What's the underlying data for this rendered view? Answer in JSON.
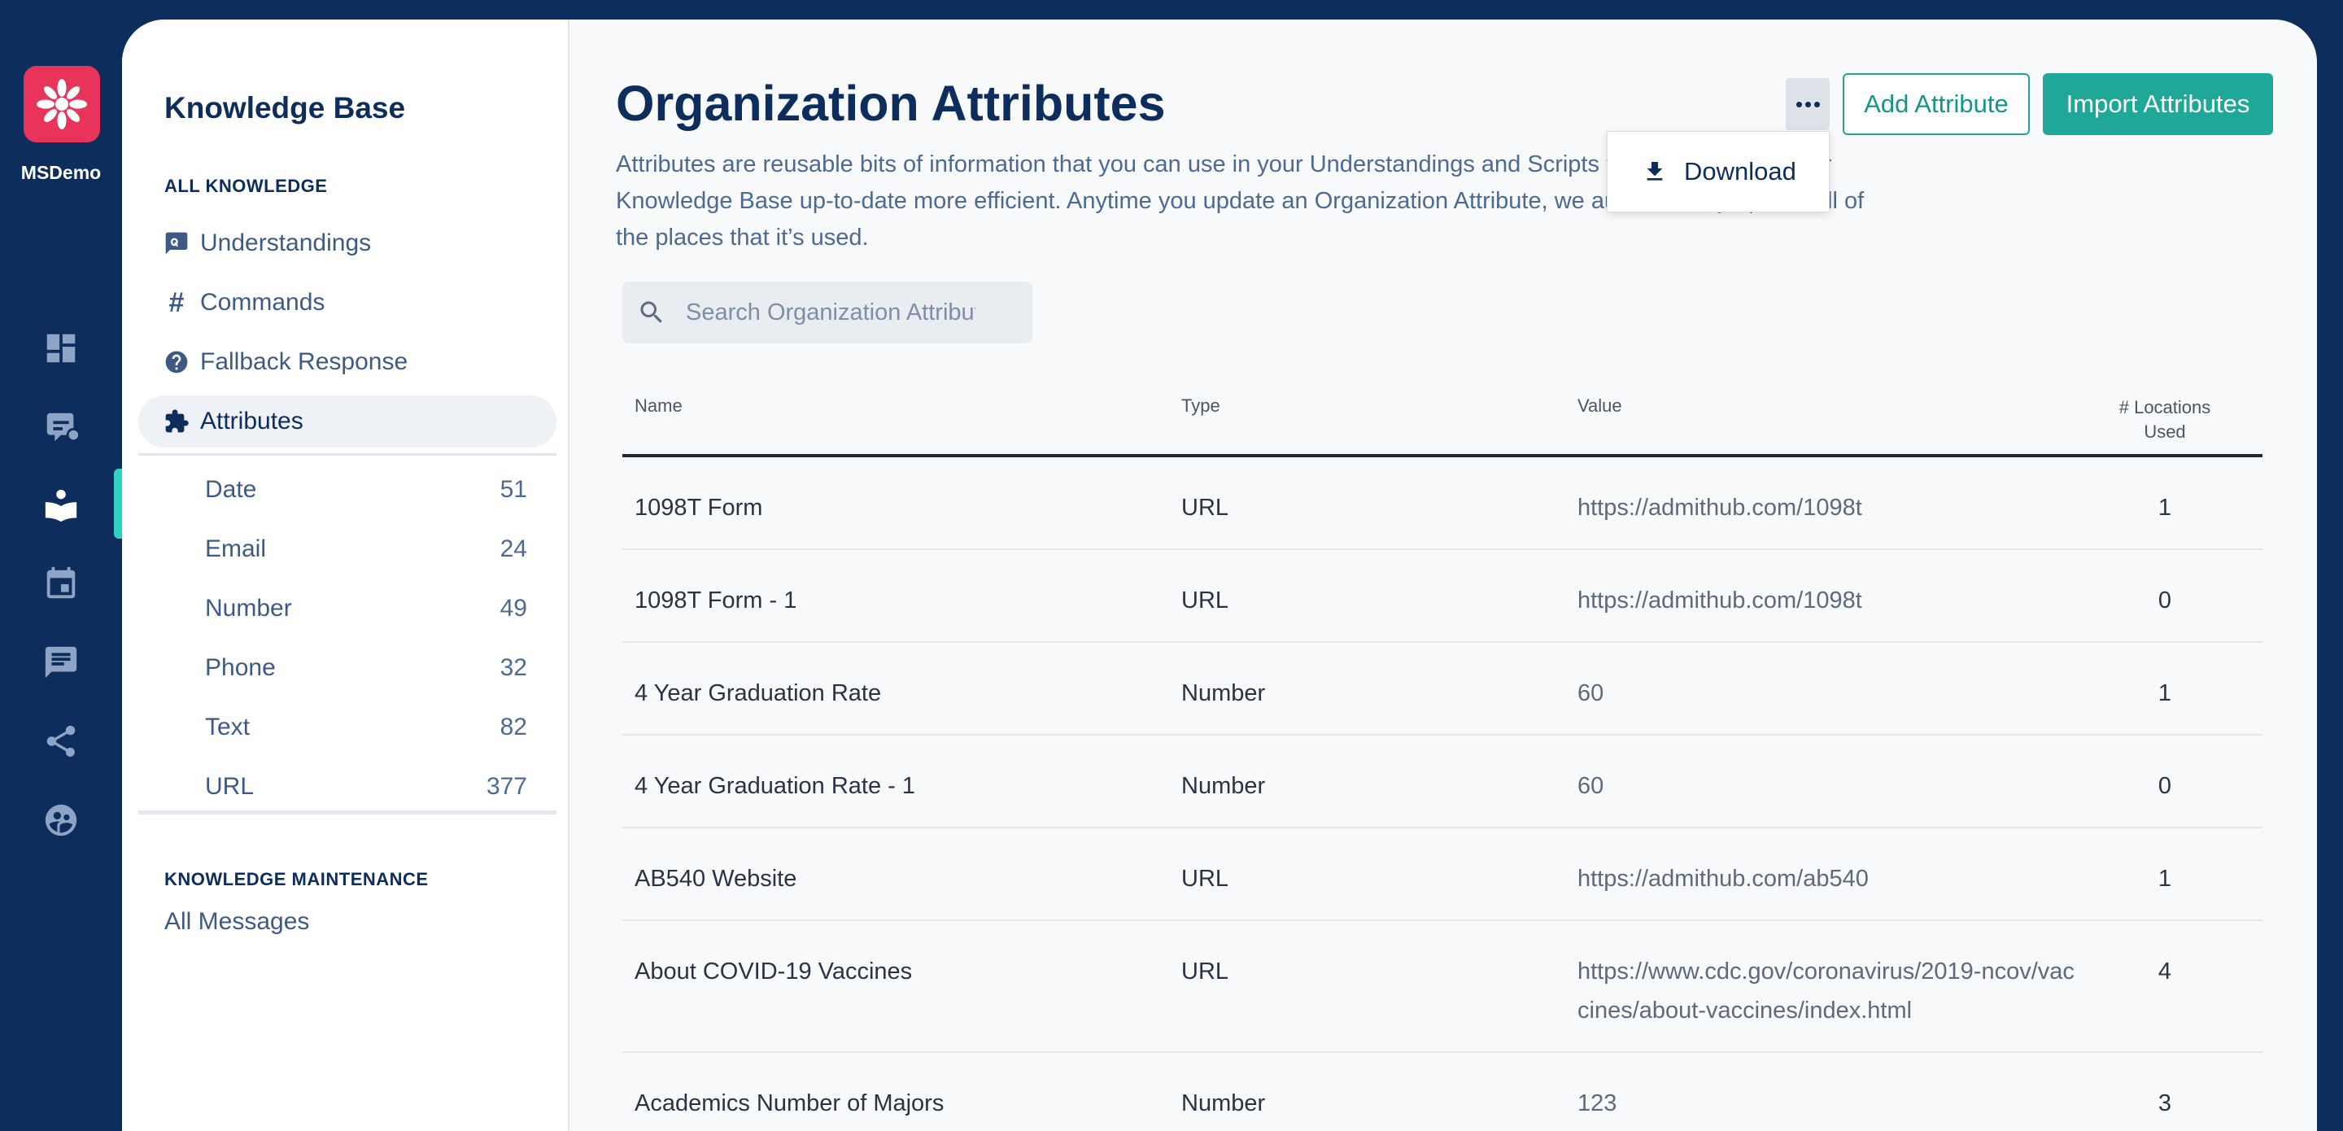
{
  "rail": {
    "org_name": "MSDemo",
    "items": [
      {
        "icon": "dashboard-icon"
      },
      {
        "icon": "conversations-icon"
      },
      {
        "icon": "knowledge-base-icon"
      },
      {
        "icon": "calendar-icon"
      },
      {
        "icon": "messages-icon"
      },
      {
        "icon": "share-icon"
      },
      {
        "icon": "audience-icon"
      }
    ],
    "active_index": 2
  },
  "sidebar": {
    "title": "Knowledge Base",
    "section_all": "ALL KNOWLEDGE",
    "nav": [
      {
        "label": "Understandings",
        "icon": "understanding-icon"
      },
      {
        "label": "Commands",
        "icon": "hash-icon",
        "glyph": "#"
      },
      {
        "label": "Fallback Response",
        "icon": "question-icon"
      },
      {
        "label": "Attributes",
        "icon": "puzzle-icon"
      }
    ],
    "attribute_types": [
      {
        "label": "Date",
        "count": "51"
      },
      {
        "label": "Email",
        "count": "24"
      },
      {
        "label": "Number",
        "count": "49"
      },
      {
        "label": "Phone",
        "count": "32"
      },
      {
        "label": "Text",
        "count": "82"
      },
      {
        "label": "URL",
        "count": "377"
      }
    ],
    "section_maintenance": "KNOWLEDGE MAINTENANCE",
    "all_messages": "All Messages"
  },
  "main": {
    "title": "Organization Attributes",
    "description": "Attributes are reusable bits of information that you can use in your Understandings and Scripts to make keeping your Knowledge Base up-to-date more efficient. Anytime you update an Organization Attribute, we automatically update all of the places that it’s used.",
    "add_button": "Add Attribute",
    "import_button": "Import Attributes",
    "menu": {
      "download": "Download"
    },
    "search": {
      "placeholder": "Search Organization Attributes",
      "value": ""
    }
  },
  "table": {
    "columns": {
      "name": "Name",
      "type": "Type",
      "value": "Value",
      "locations": "# Locations Used"
    },
    "rows": [
      {
        "name": "1098T Form",
        "type": "URL",
        "value": "https://admithub.com/1098t",
        "locations": "1"
      },
      {
        "name": "1098T Form - 1",
        "type": "URL",
        "value": "https://admithub.com/1098t",
        "locations": "0"
      },
      {
        "name": "4 Year Graduation Rate",
        "type": "Number",
        "value": "60",
        "locations": "1"
      },
      {
        "name": "4 Year Graduation Rate - 1",
        "type": "Number",
        "value": "60",
        "locations": "0"
      },
      {
        "name": "AB540 Website",
        "type": "URL",
        "value": "https://admithub.com/ab540",
        "locations": "1"
      },
      {
        "name": "About COVID-19 Vaccines",
        "type": "URL",
        "value": "https://www.cdc.gov/coronavirus/2019-ncov/vaccines/about-vaccines/index.html",
        "locations": "4"
      },
      {
        "name": "Academics Number of Majors",
        "type": "Number",
        "value": "123",
        "locations": "3"
      }
    ]
  },
  "colors": {
    "brand_navy": "#0d2d5c",
    "accent_teal": "#1fa898",
    "logo_pink": "#e8335a",
    "active_marker": "#2ed3c2"
  }
}
